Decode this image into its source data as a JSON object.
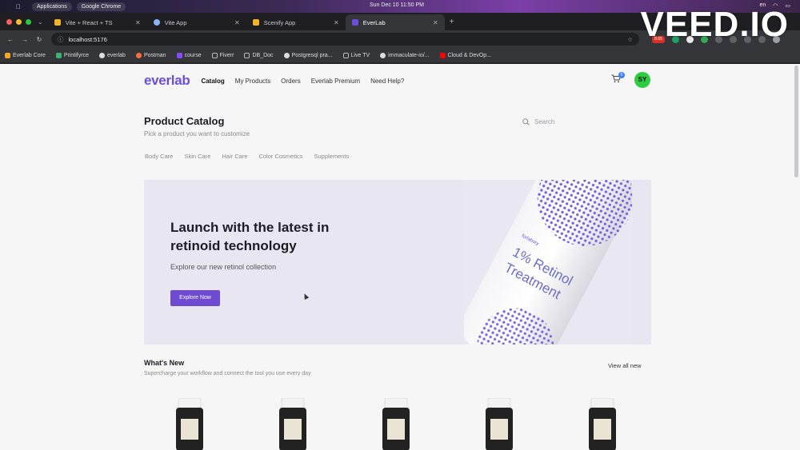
{
  "os_bar": {
    "menu_items": [
      "Applications",
      "Google Chrome"
    ],
    "clock": "Sun Dec 10  11:50 PM",
    "language": "en"
  },
  "browser": {
    "tabs": [
      {
        "label": "Vite + React + TS",
        "favicon_color": "#f0b429"
      },
      {
        "label": "Vite App",
        "favicon_color": "#8ab4f8"
      },
      {
        "label": "Scenify App",
        "favicon_color": "#f0b429"
      },
      {
        "label": "EverLab",
        "favicon_color": "#6c4ed9",
        "active": true
      }
    ],
    "address": "localhost:5176",
    "extension_badge": "8.65",
    "bookmarks": [
      {
        "label": "Everlab Core",
        "color": "#f5a623"
      },
      {
        "label": "Printifyrce",
        "color": "#3cb371"
      },
      {
        "label": "everlab",
        "color": "#dddddd"
      },
      {
        "label": "Postman",
        "color": "#ff6c37"
      },
      {
        "label": "course",
        "color": "#8a4bff"
      },
      {
        "label": "Fiverr",
        "color": "#999999"
      },
      {
        "label": "DB_Doc",
        "color": "#999999"
      },
      {
        "label": "Postgresql pra...",
        "color": "#dddddd"
      },
      {
        "label": "Live TV",
        "color": "#999999"
      },
      {
        "label": "immaculate-io/...",
        "color": "#dddddd"
      },
      {
        "label": "Cloud & DevOp...",
        "color": "#ff0000"
      }
    ]
  },
  "watermark": "VEED.IO",
  "site": {
    "logo": "everlab",
    "nav": [
      "Catalog",
      "My Products",
      "Orders",
      "Everlab Premium",
      "Need Help?"
    ],
    "active_nav": "Catalog",
    "cart_count": "0",
    "avatar_initials": "SY",
    "accent_color": "#6c4ed9"
  },
  "catalog": {
    "title": "Product Catalog",
    "subtitle": "Pick a product you want to customize",
    "search_placeholder": "Search",
    "categories": [
      "Body Care",
      "Skin Care",
      "Hair Care",
      "Color Cosmetics",
      "Supplements"
    ]
  },
  "hero": {
    "title": "Launch with the latest in retinoid technology",
    "subtitle": "Explore our new retinol collection",
    "button": "Explore Now",
    "bottle_brand": "forlabory",
    "bottle_line1": "1% Retinol",
    "bottle_line2": "Treatment"
  },
  "whats_new": {
    "title": "What's New",
    "subtitle": "Supercharge your workflow and connect the tool you use every day",
    "view_all": "View all new",
    "product_count_visible": 5
  }
}
